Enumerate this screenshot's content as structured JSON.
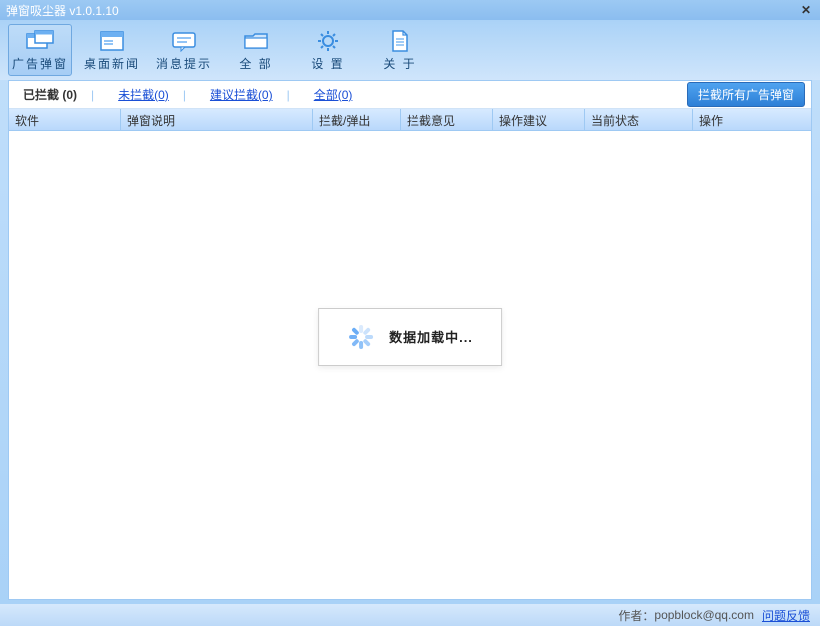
{
  "window": {
    "title": "弹窗吸尘器  v1.0.1.10"
  },
  "toolbar": {
    "items": [
      {
        "label": "广告弹窗"
      },
      {
        "label": "桌面新闻"
      },
      {
        "label": "消息提示"
      },
      {
        "label": "全 部"
      },
      {
        "label": "设 置"
      },
      {
        "label": "关 于"
      }
    ]
  },
  "tabs": {
    "blocked": "已拦截 (0)",
    "unblocked": "未拦截(0)",
    "suggest": "建议拦截(0)",
    "all": "全部(0)"
  },
  "block_all_btn": "拦截所有广告弹窗",
  "columns": {
    "c1": "软件",
    "c2": "弹窗说明",
    "c3": "拦截/弹出",
    "c4": "拦截意见",
    "c5": "操作建议",
    "c6": "当前状态",
    "c7": "操作"
  },
  "loading": "数据加载中...",
  "footer": {
    "author_label": "作者：",
    "author": "popblock@qq.com",
    "feedback": "问题反馈"
  }
}
